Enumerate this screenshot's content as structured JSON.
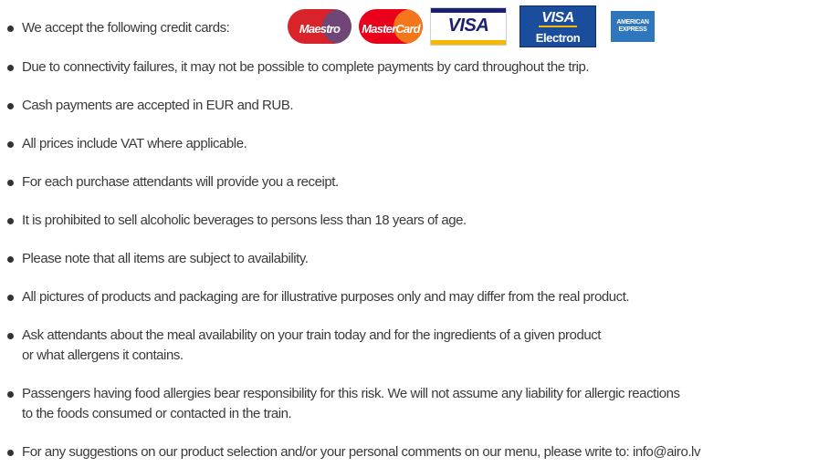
{
  "cards_intro": "We accept the following credit cards:",
  "cards": [
    {
      "name": "Maestro",
      "label": "Maestro",
      "color": "#d8232a"
    },
    {
      "name": "MasterCard",
      "label": "MasterCard",
      "color": "#ea001b"
    },
    {
      "name": "VISA",
      "label": "VISA",
      "color": "#1a1f71"
    },
    {
      "name": "VISA Electron",
      "label_top": "VISA",
      "label_bottom": "Electron",
      "color": "#1a4d9c"
    },
    {
      "name": "American Express",
      "label_top": "AMERICAN",
      "label_bottom": "EXPRESS",
      "color": "#2e77bc"
    }
  ],
  "items": [
    {
      "lines": [
        "Due to connectivity failures, it may not be possible to complete payments by card throughout the trip."
      ]
    },
    {
      "lines": [
        "Cash payments are accepted in EUR and RUB."
      ]
    },
    {
      "lines": [
        "All prices include VAT where applicable."
      ]
    },
    {
      "lines": [
        "For each purchase attendants will provide you a receipt."
      ]
    },
    {
      "lines": [
        "It is prohibited to sell alcoholic beverages to persons less than 18 years of age."
      ]
    },
    {
      "lines": [
        "Please note that all items are subject to availability."
      ]
    },
    {
      "lines": [
        "All pictures of products and packaging are for illustrative purposes only and may differ from the real product."
      ]
    },
    {
      "lines": [
        "Ask attendants about the meal availability on your train today and for the ingredients of a given product",
        "or what allergens it contains."
      ]
    },
    {
      "lines": [
        "Passengers having food allergies bear responsibility for this risk. We will not assume any liability for allergic reactions",
        "to the foods consumed or contacted in the train."
      ]
    },
    {
      "lines": [
        "For any suggestions on our product selection and/or your personal comments on our menu, please write to: info@airo.lv"
      ]
    }
  ]
}
